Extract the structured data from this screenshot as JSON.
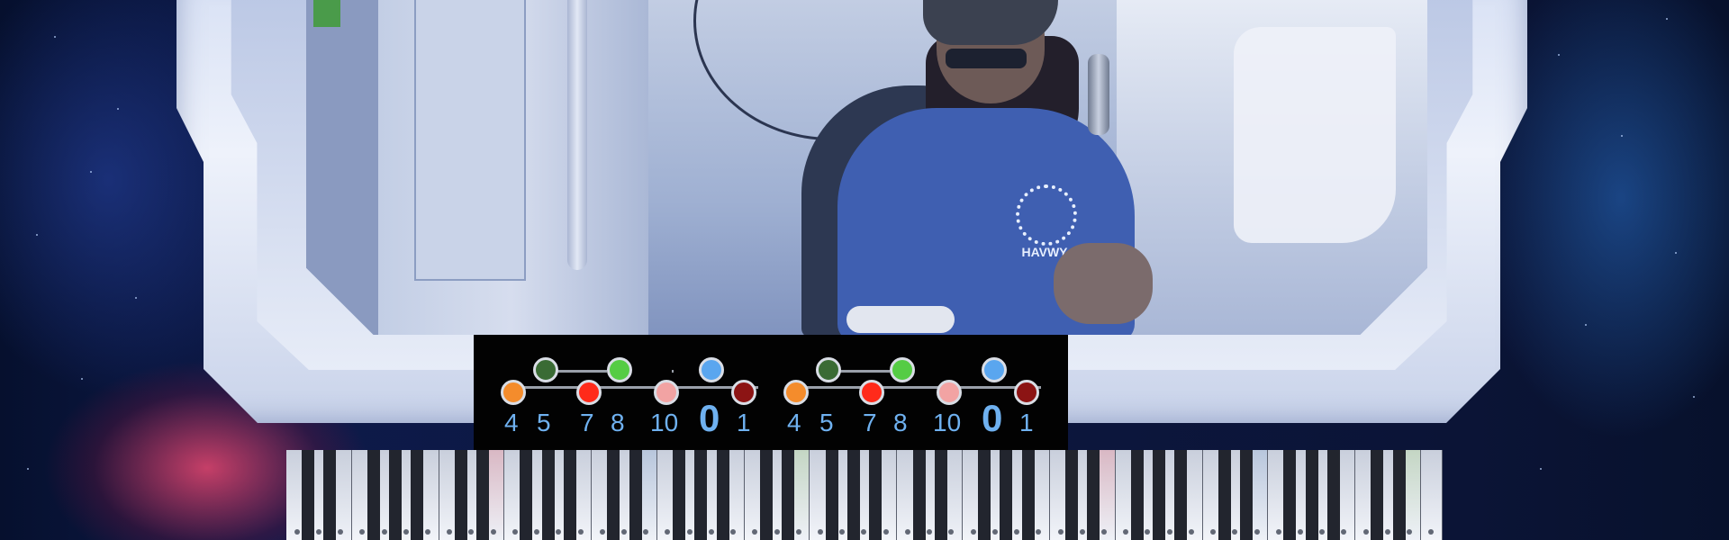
{
  "scene": {
    "description_colors": {
      "shirt": "#3f5fb1",
      "frame": "#e3e9f6",
      "space": "#0d1a4a"
    }
  },
  "shirt_logo": {
    "text": "HAVWY"
  },
  "chord_diagram": {
    "groups": [
      {
        "dots": [
          {
            "color": "#f48c2c",
            "row": "low",
            "label": "4"
          },
          {
            "color": "#3a6b34",
            "row": "high",
            "label": "5"
          },
          {
            "color": "#ff2a1a",
            "row": "low",
            "label": "7"
          },
          {
            "color": "#55cc44",
            "row": "high",
            "label": "8"
          },
          {
            "color": "#f2a3a3",
            "row": "low",
            "label": "10"
          },
          {
            "color": "#5aa6ef",
            "row": "high",
            "label": "0"
          },
          {
            "color": "#8c1414",
            "row": "low",
            "label": "1"
          }
        ]
      },
      {
        "dots": [
          {
            "color": "#f48c2c",
            "row": "low",
            "label": "4"
          },
          {
            "color": "#3a6b34",
            "row": "high",
            "label": "5"
          },
          {
            "color": "#ff2a1a",
            "row": "low",
            "label": "7"
          },
          {
            "color": "#55cc44",
            "row": "high",
            "label": "8"
          },
          {
            "color": "#f2a3a3",
            "row": "low",
            "label": "10"
          },
          {
            "color": "#5aa6ef",
            "row": "high",
            "label": "0"
          },
          {
            "color": "#8c1414",
            "row": "low",
            "label": "1"
          }
        ]
      }
    ],
    "labels": {
      "g1_4": "4",
      "g1_5": "5",
      "g1_7": "7",
      "g1_8": "8",
      "g1_10": "10",
      "g1_0": "0",
      "g1_1": "1",
      "g2_4": "4",
      "g2_5": "5",
      "g2_7": "7",
      "g2_8": "8",
      "g2_10": "10",
      "g2_0": "0",
      "g2_1": "1"
    }
  },
  "keyboard": {
    "white_key_count": 53
  }
}
